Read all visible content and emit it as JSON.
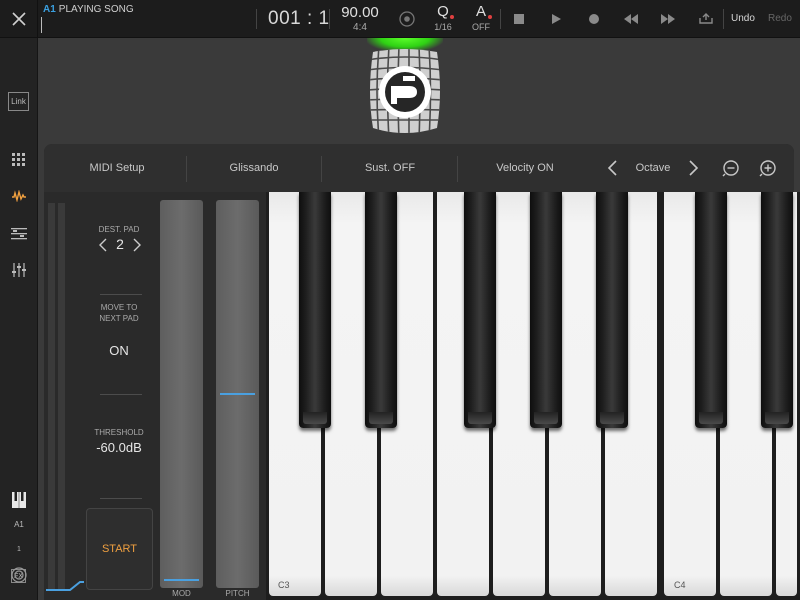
{
  "topbar": {
    "slot_id": "A1",
    "song_label": "PLAYING SONG",
    "position": "001 : 1",
    "tempo": "90.00",
    "time_signature": "4:4",
    "quantize_label": "Q",
    "quantize_value": "1/16",
    "automation_label": "A",
    "automation_value": "OFF",
    "undo": "Undo",
    "redo": "Redo"
  },
  "rail": {
    "link": "Link",
    "instrument_slot": "A1",
    "instrument_number": "1",
    "fx": "FX"
  },
  "toolbar": {
    "midi_setup": "MIDI Setup",
    "glissando": "Glissando",
    "sustain": "Sust. OFF",
    "velocity": "Velocity ON",
    "octave": "Octave"
  },
  "side": {
    "dest_pad_label": "DEST. PAD",
    "dest_pad_value": "2",
    "move_label_1": "MOVE TO",
    "move_label_2": "NEXT PAD",
    "move_value": "ON",
    "threshold_label": "THRESHOLD",
    "threshold_value": "-60.0dB",
    "start": "START"
  },
  "wheels": {
    "mod_label": "MOD",
    "pitch_label": "PITCH"
  },
  "keyboard": {
    "labels": [
      "C3",
      "C4"
    ]
  },
  "colors": {
    "accent_blue": "#3aa0e0",
    "start_orange": "#f0a040",
    "glow_green": "#2fd214"
  }
}
